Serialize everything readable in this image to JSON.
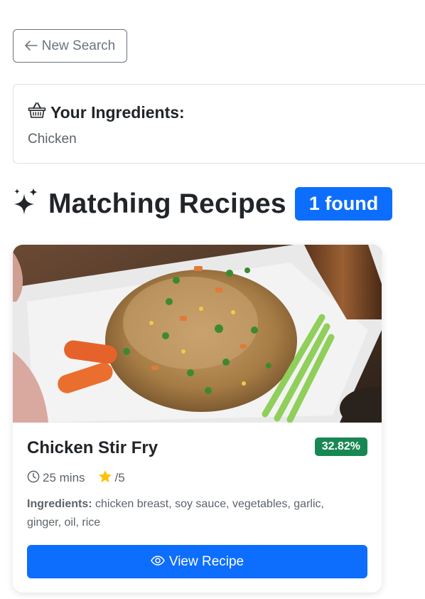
{
  "nav": {
    "new_search_label": "New Search",
    "back_icon": "arrow-left-icon"
  },
  "ingredients": {
    "title": "Your Ingredients:",
    "value": "Chicken",
    "icon": "basket-icon"
  },
  "results": {
    "title": "Matching Recipes",
    "count_badge": "1 found",
    "icon": "sparkles-icon"
  },
  "recipes": [
    {
      "name": "Chicken Stir Fry",
      "match": "32.82%",
      "time": "25 mins",
      "rating": "/5",
      "ingredients_label": "Ingredients:",
      "ingredients": "chicken breast, soy sauce, vegetables, garlic, ginger, oil, rice",
      "view_label": "View Recipe"
    }
  ],
  "colors": {
    "primary": "#0d6efd",
    "success": "#198754",
    "secondary": "#6c757d",
    "star": "#ffc107"
  }
}
